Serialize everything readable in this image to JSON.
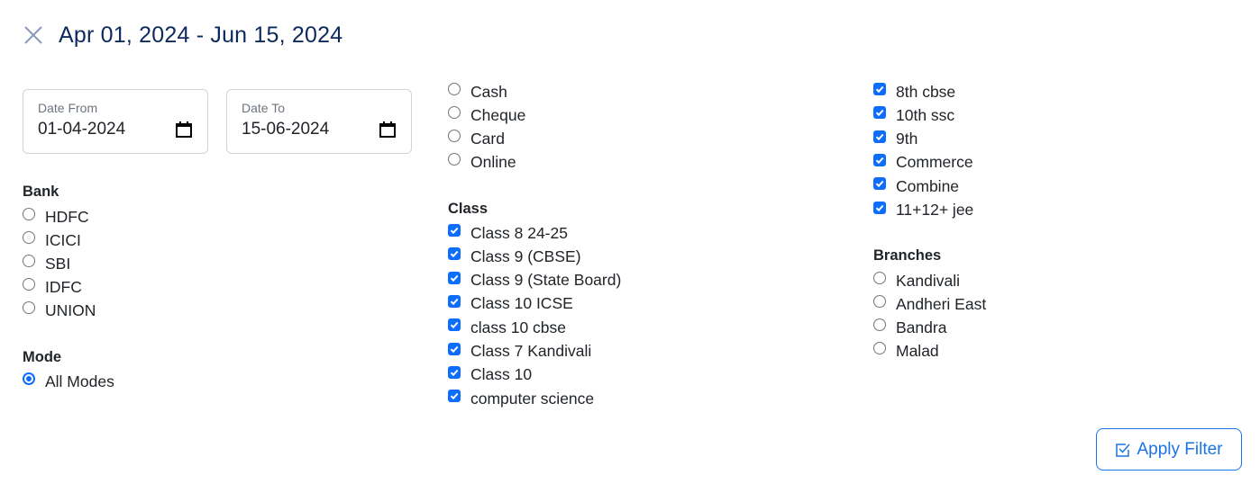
{
  "header": {
    "title": "Apr 01, 2024 - Jun 15, 2024",
    "close_icon": "close-icon"
  },
  "date_from": {
    "label": "Date From",
    "value": "01-04-2024",
    "icon": "calendar-icon"
  },
  "date_to": {
    "label": "Date To",
    "value": "15-06-2024",
    "icon": "calendar-icon"
  },
  "bank": {
    "title": "Bank",
    "options": [
      {
        "label": "HDFC",
        "checked": false
      },
      {
        "label": "ICICI",
        "checked": false
      },
      {
        "label": "SBI",
        "checked": false
      },
      {
        "label": "IDFC",
        "checked": false
      },
      {
        "label": "UNION",
        "checked": false
      }
    ]
  },
  "mode": {
    "title": "Mode",
    "options": [
      {
        "label": "All Modes",
        "checked": true
      },
      {
        "label": "Cash",
        "checked": false
      },
      {
        "label": "Cheque",
        "checked": false
      },
      {
        "label": "Card",
        "checked": false
      },
      {
        "label": "Online",
        "checked": false
      }
    ]
  },
  "class": {
    "title": "Class",
    "options": [
      {
        "label": "Class 8 24-25",
        "checked": true
      },
      {
        "label": "Class 9 (CBSE)",
        "checked": true
      },
      {
        "label": "Class 9 (State Board)",
        "checked": true
      },
      {
        "label": "Class 10 ICSE",
        "checked": true
      },
      {
        "label": "class 10 cbse",
        "checked": true
      },
      {
        "label": "Class 7 Kandivali",
        "checked": true
      },
      {
        "label": "Class 10",
        "checked": true
      },
      {
        "label": "computer science",
        "checked": true
      },
      {
        "label": "8th cbse",
        "checked": true
      },
      {
        "label": "10th ssc",
        "checked": true
      },
      {
        "label": "9th",
        "checked": true
      },
      {
        "label": "Commerce",
        "checked": true
      },
      {
        "label": "Combine",
        "checked": true
      },
      {
        "label": "11+12+ jee",
        "checked": true
      }
    ]
  },
  "branches": {
    "title": "Branches",
    "options": [
      {
        "label": "Kandivali",
        "checked": false
      },
      {
        "label": "Andheri East",
        "checked": false
      },
      {
        "label": "Bandra",
        "checked": false
      },
      {
        "label": "Malad",
        "checked": false
      }
    ]
  },
  "apply_button": {
    "label": "Apply Filter",
    "icon": "check-square-icon"
  },
  "colors": {
    "accent": "#0d6efd",
    "title": "#0d2a5c",
    "button": "#1a73e8"
  }
}
